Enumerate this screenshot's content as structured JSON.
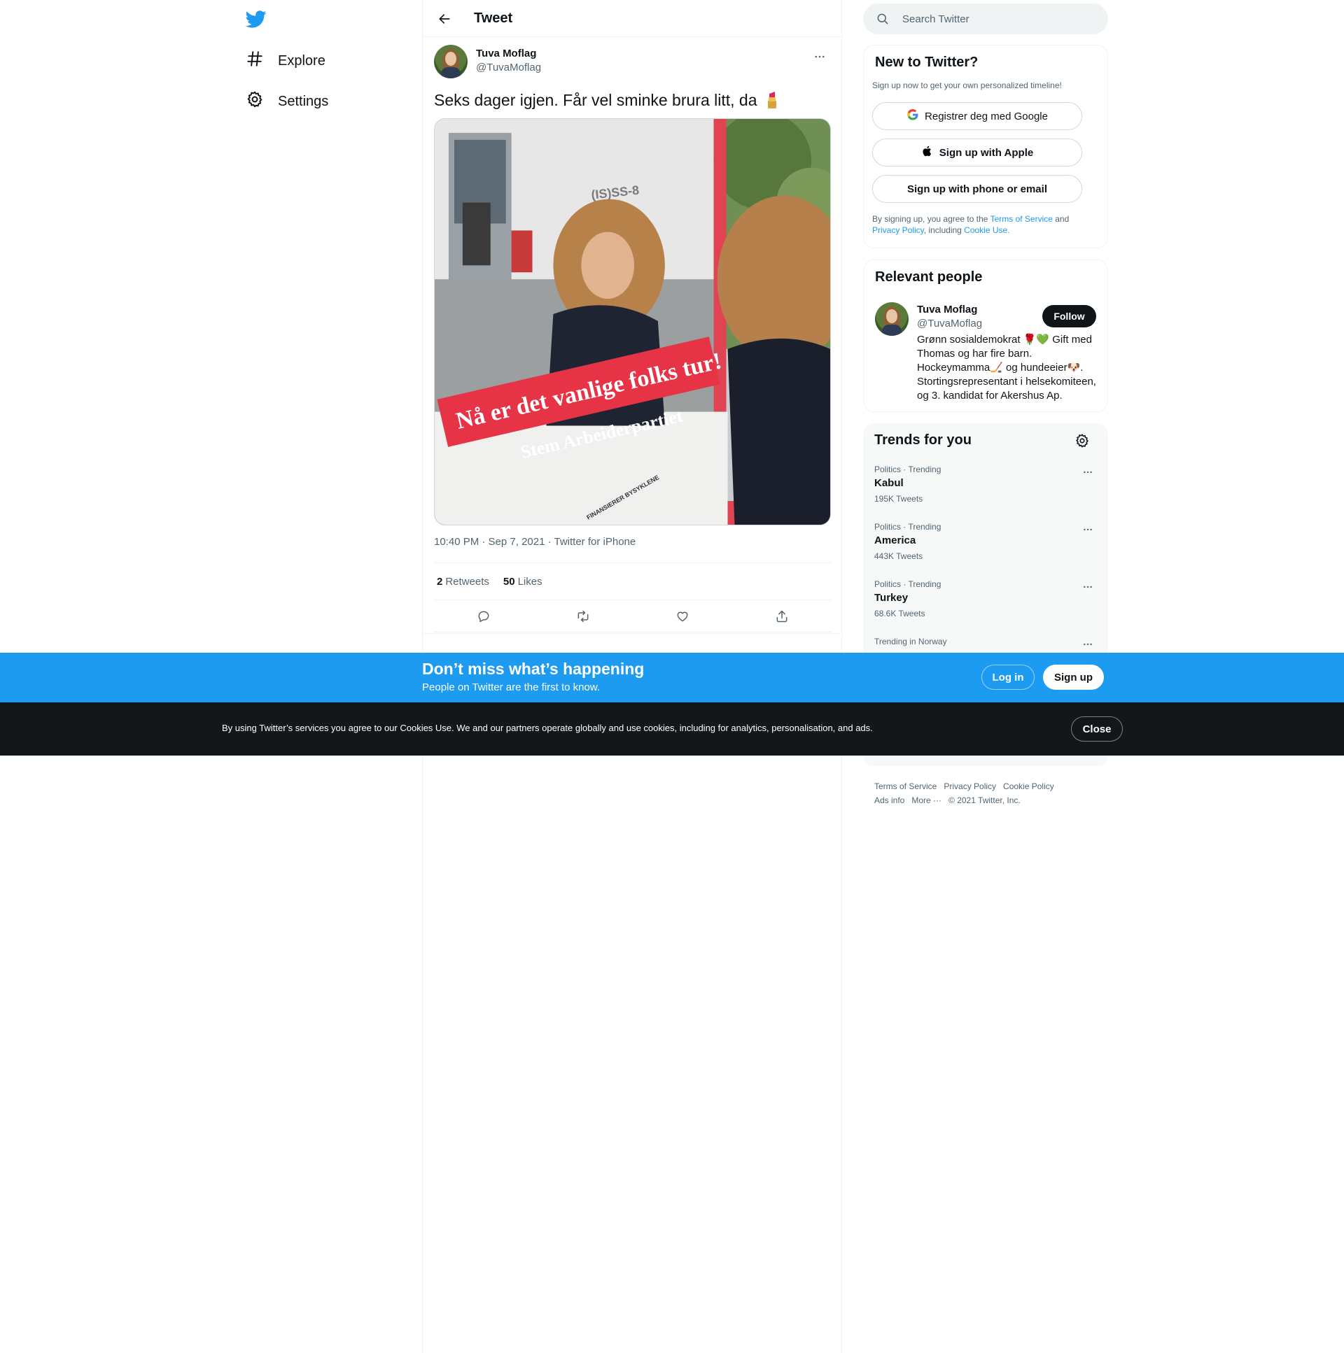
{
  "nav": {
    "items": [
      {
        "label": "Explore",
        "icon": "hashtag-icon"
      },
      {
        "label": "Settings",
        "icon": "gear-icon"
      }
    ]
  },
  "header": {
    "title": "Tweet"
  },
  "tweet": {
    "author_name": "Tuva Moflag",
    "author_handle": "@TuvaMoflag",
    "text": "Seks dager igjen. Får vel sminke brura litt, da",
    "image_text": {
      "banner": "Nå er det vanlige folks tur!",
      "party": "Stem Arbeiderpartiet",
      "store_sign": "(IS)SS-8",
      "bottom": "FINANSIERER BYSYKLENE"
    },
    "meta": "10:40 PM · Sep 7, 2021 · Twitter for iPhone",
    "retweets_count": "2",
    "retweets_label": "Retweets",
    "likes_count": "50",
    "likes_label": "Likes"
  },
  "search": {
    "placeholder": "Search Twitter"
  },
  "signup": {
    "title": "New to Twitter?",
    "subtitle": "Sign up now to get your own personalized timeline!",
    "google": "Registrer deg med Google",
    "apple": "Sign up with Apple",
    "phone": "Sign up with phone or email",
    "legal_pre": "By signing up, you agree to the ",
    "terms": "Terms of Service",
    "and": " and ",
    "privacy": "Privacy Policy",
    "including": ", including ",
    "cookie": "Cookie Use."
  },
  "people": {
    "title": "Relevant people",
    "name": "Tuva Moflag",
    "handle": "@TuvaMoflag",
    "follow": "Follow",
    "bio": "Grønn sosialdemokrat 🌹💚 Gift med Thomas og har fire barn. Hockeymamma🏒 og hundeeier🐶. Stortingsrepresentant i helsekomiteen, og 3. kandidat for Akershus Ap."
  },
  "trends": {
    "title": "Trends for you",
    "items": [
      {
        "category": "Politics · Trending",
        "name": "Kabul",
        "count": "195K Tweets"
      },
      {
        "category": "Politics · Trending",
        "name": "America",
        "count": "443K Tweets"
      },
      {
        "category": "Politics · Trending",
        "name": "Turkey",
        "count": "68.6K Tweets"
      },
      {
        "category": "Trending in Norway",
        "name": "",
        "count": ""
      }
    ]
  },
  "footer": {
    "terms": "Terms of Service",
    "privacy": "Privacy Policy",
    "cookie": "Cookie Policy",
    "ads": "Ads info",
    "more": "More ···",
    "copyright": "© 2021 Twitter, Inc."
  },
  "bottom_bar": {
    "title": "Don’t miss what’s happening",
    "subtitle": "People on Twitter are the first to know.",
    "login": "Log in",
    "signup": "Sign up"
  },
  "cookie_bar": {
    "text": "By using Twitter’s services you agree to our Cookies Use. We and our partners operate globally and use cookies, including for analytics, personalisation, and ads.",
    "close": "Close"
  },
  "colors": {
    "accent": "#1d9bf0",
    "text": "#0f1419",
    "muted": "#536471",
    "cookie_bg": "#14171a",
    "banner_red": "#e63346"
  }
}
